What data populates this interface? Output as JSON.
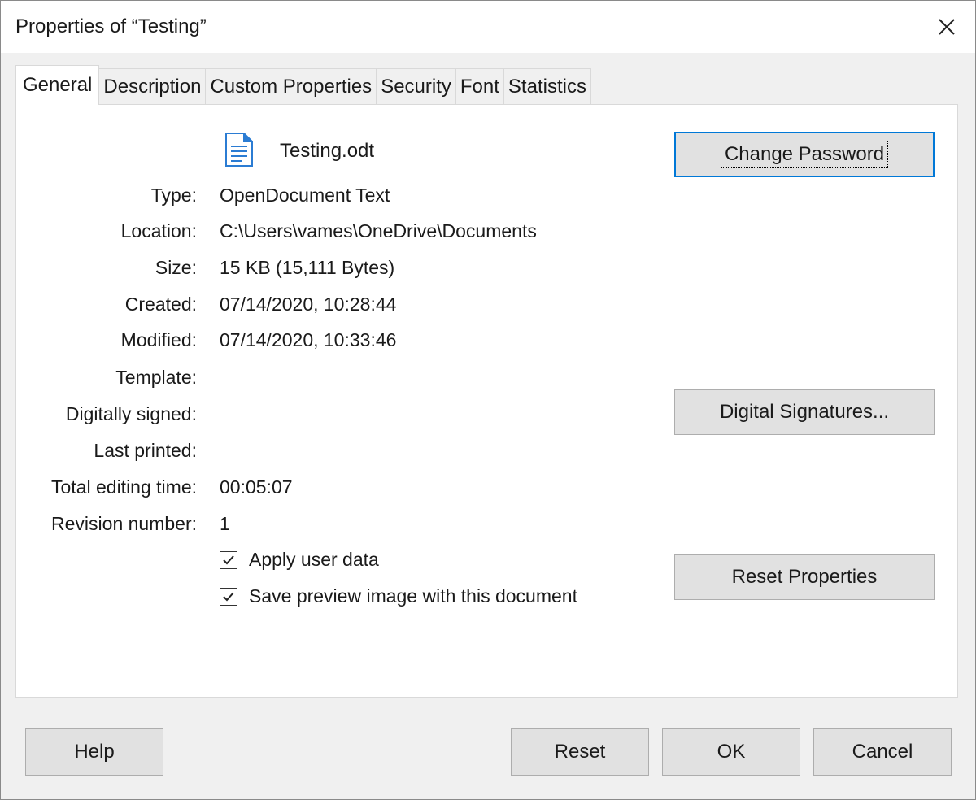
{
  "window": {
    "title": "Properties of “Testing”"
  },
  "tabs": [
    {
      "label": "General",
      "active": true
    },
    {
      "label": "Description",
      "active": false
    },
    {
      "label": "Custom Properties",
      "active": false
    },
    {
      "label": "Security",
      "active": false
    },
    {
      "label": "Font",
      "active": false
    },
    {
      "label": "Statistics",
      "active": false
    }
  ],
  "general": {
    "file_name": "Testing.odt",
    "file_icon": "document-icon",
    "fields": [
      {
        "label": "Type:",
        "value": "OpenDocument Text"
      },
      {
        "label": "Location:",
        "value": "C:\\Users\\vames\\OneDrive\\Documents"
      },
      {
        "label": "Size:",
        "value": "15 KB (15,111 Bytes)"
      },
      {
        "label": "Created:",
        "value": "07/14/2020, 10:28:44"
      },
      {
        "label": "Modified:",
        "value": "07/14/2020, 10:33:46"
      },
      {
        "label": "Template:",
        "value": ""
      },
      {
        "label": "Digitally signed:",
        "value": ""
      },
      {
        "label": "Last printed:",
        "value": ""
      },
      {
        "label": "Total editing time:",
        "value": "00:05:07"
      },
      {
        "label": "Revision number:",
        "value": "1"
      }
    ],
    "apply_user_data": {
      "label": "Apply user data",
      "checked": true
    },
    "save_preview": {
      "label": "Save preview image with this document",
      "checked": true
    },
    "change_password_label": "Change Password",
    "digital_signatures_label": "Digital Signatures...",
    "reset_properties_label": "Reset Properties"
  },
  "footer": {
    "help_label": "Help",
    "reset_label": "Reset",
    "ok_label": "OK",
    "cancel_label": "Cancel"
  },
  "colors": {
    "accent": "#0078d7",
    "button_bg": "#e1e1e1",
    "panel_bg": "#ffffff",
    "window_bg": "#f0f0f0"
  }
}
